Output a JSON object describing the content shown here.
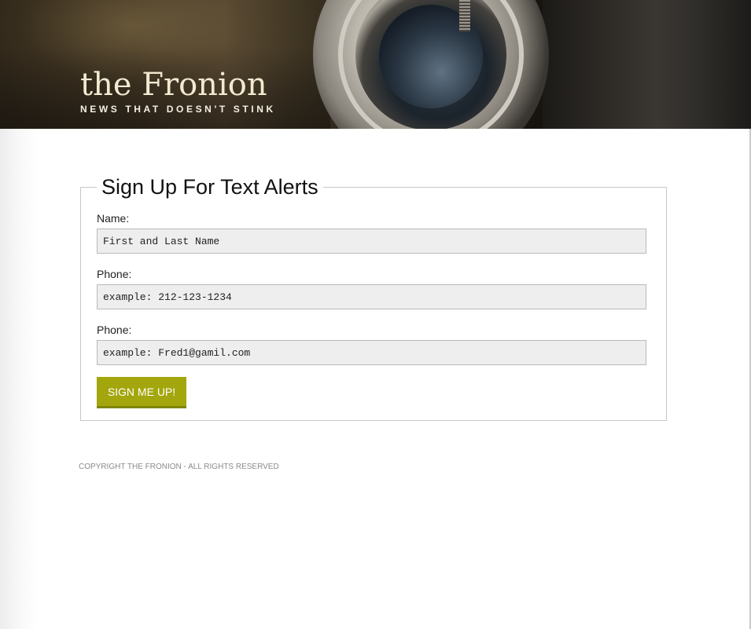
{
  "header": {
    "brand_name": "the Fronion",
    "tagline": "NEWS THAT DOESN'T STINK"
  },
  "form": {
    "legend": "Sign Up For Text Alerts",
    "fields": [
      {
        "label": "Name:",
        "placeholder": "First and Last Name"
      },
      {
        "label": "Phone:",
        "placeholder": "example: 212-123-1234"
      },
      {
        "label": "Phone:",
        "placeholder": "example: Fred1@gamil.com"
      }
    ],
    "submit_label": "SIGN ME UP!"
  },
  "footer": {
    "copyright": "COPYRIGHT THE FRONION - ALL RIGHTS RESERVED"
  },
  "colors": {
    "accent": "#a3a60c",
    "brand_text": "#f2ead0",
    "input_bg": "#eeeeee"
  }
}
